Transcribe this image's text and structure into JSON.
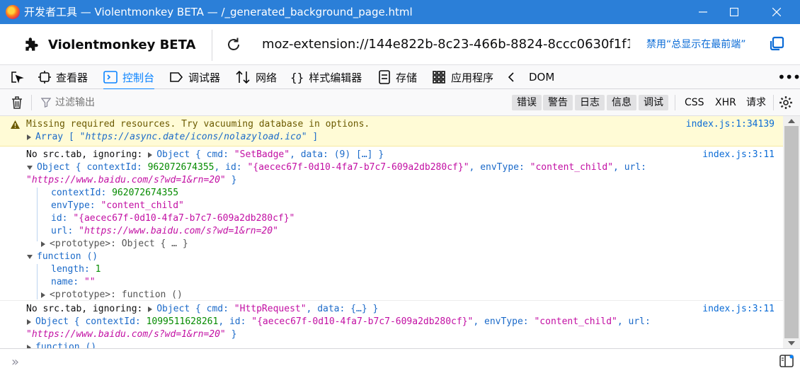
{
  "window": {
    "title": "开发者工具 — Violentmonkey BETA — /_generated_background_page.html"
  },
  "toolbar": {
    "extension_name": "Violentmonkey BETA",
    "url": "moz-extension://144e822b-8c23-466b-8824-8ccc0630f1f1…",
    "pin_label": "禁用“总显示在最前端”"
  },
  "tabs": [
    {
      "label": "查看器",
      "icon": "inspector-icon"
    },
    {
      "label": "控制台",
      "icon": "console-icon",
      "active": true
    },
    {
      "label": "调试器",
      "icon": "debugger-icon"
    },
    {
      "label": "网络",
      "icon": "network-icon"
    },
    {
      "label": "样式编辑器",
      "icon": "style-editor-icon"
    },
    {
      "label": "存储",
      "icon": "storage-icon"
    },
    {
      "label": "应用程序",
      "icon": "application-icon"
    },
    {
      "label": "DOM",
      "icon": "dom-icon"
    }
  ],
  "filter": {
    "placeholder": "过滤输出",
    "levels": [
      "错误",
      "警告",
      "日志",
      "信息",
      "调试"
    ],
    "types": [
      "CSS",
      "XHR",
      "请求"
    ]
  },
  "messages": {
    "m1": {
      "text": "Missing required resources. Try vacuuming database in options.",
      "array_label": "Array",
      "array_value": "\"https://async.date/icons/nolazyload.ico\"",
      "source": "index.js:1:34139"
    },
    "m2": {
      "prefix": "No src.tab, ignoring:",
      "obj_label": "Object",
      "cmd_key": "cmd:",
      "cmd_value": "\"SetBadge\"",
      "data_key": "data:",
      "data_value": "(9) […]",
      "source": "index.js:3:11",
      "ctx_id": "962072674355",
      "id_value": "\"{aecec67f-0d10-4fa7-b7c7-609a2db280cf}\"",
      "env_value": "\"content_child\"",
      "url_value": "\"https://www.baidu.com/s?wd=1&rn=20\"",
      "proto_obj": "<prototype>: Object { … }",
      "function_label": "function ()",
      "length_value": "1",
      "name_value": "\"\"",
      "proto_fn": "<prototype>: function ()"
    },
    "m3": {
      "prefix": "No src.tab, ignoring:",
      "cmd_value": "\"HttpRequest\"",
      "data_value": "{…}",
      "source": "index.js:3:11",
      "ctx_id": "1099511628261",
      "id_value": "\"{aecec67f-0d10-4fa7-b7c7-609a2db280cf}\"",
      "env_value": "\"content_child\"",
      "url_value": "\"https://www.baidu.com/s?wd=1&rn=20\"",
      "function_label": "function ()"
    }
  },
  "keys": {
    "contextId": "contextId:",
    "envType": "envType:",
    "id": "id:",
    "url": "url:",
    "length": "length:",
    "name": "name:"
  },
  "input": {
    "prompt": "»"
  },
  "colors": {
    "titlebar": "#2b7fd8",
    "accent": "#0a84ff",
    "warning_bg": "#fffbd6",
    "string": "#c20fa3",
    "number": "#058b00"
  }
}
